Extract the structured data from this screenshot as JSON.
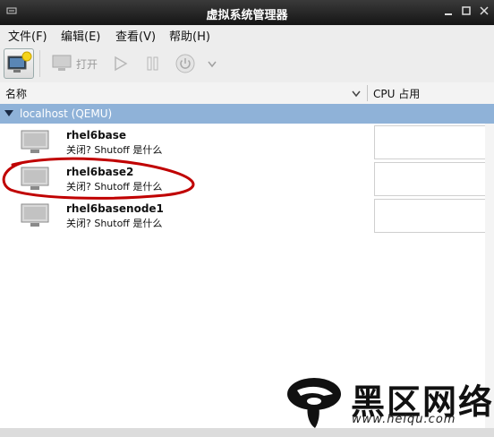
{
  "window": {
    "title": "虚拟系统管理器"
  },
  "menu": {
    "file": "文件(F)",
    "edit": "编辑(E)",
    "view": "查看(V)",
    "help": "帮助(H)"
  },
  "toolbar": {
    "open_label": "打开"
  },
  "columns": {
    "name": "名称",
    "cpu": "CPU 占用"
  },
  "connection": {
    "label": "localhost (QEMU)"
  },
  "vms": [
    {
      "name": "rhel6base",
      "status": "关闭? Shutoff 是什么"
    },
    {
      "name": "rhel6base2",
      "status": "关闭? Shutoff 是什么"
    },
    {
      "name": "rhel6basenode1",
      "status": "关闭? Shutoff 是什么"
    }
  ],
  "watermark": {
    "text": "黑区网络",
    "url": "www.heiqu.com"
  },
  "colors": {
    "titlebar": "#202020",
    "group_row": "#8fb2d8",
    "annotation": "#c00000"
  }
}
